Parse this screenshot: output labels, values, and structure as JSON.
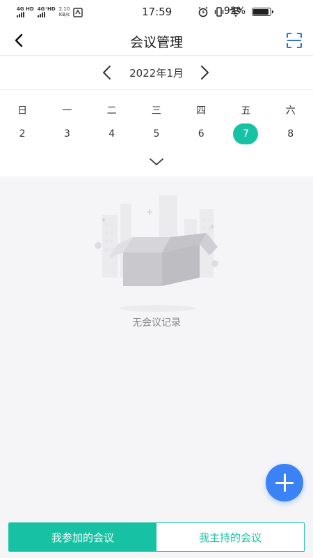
{
  "status_bar": {
    "network_1": "4G HD",
    "network_2": "4G⁺HD",
    "speed_value": "2.10",
    "speed_unit": "KB/s",
    "time": "17:59",
    "battery_percent": "93%",
    "battery_level": 0.93,
    "icons": [
      "signal-icon",
      "signal-icon",
      "sim-icon",
      "alarm-icon",
      "vibrate-icon",
      "wifi-icon",
      "battery-icon"
    ]
  },
  "header": {
    "title": "会议管理",
    "back_icon": "chevron-left-icon",
    "scan_icon": "scan-icon"
  },
  "calendar": {
    "month_label": "2022年1月",
    "weekdays": [
      "日",
      "一",
      "二",
      "三",
      "四",
      "五",
      "六"
    ],
    "dates": [
      "2",
      "3",
      "4",
      "5",
      "6",
      "7",
      "8"
    ],
    "selected_date": "7",
    "expand_icon": "chevron-down-icon"
  },
  "empty_state": {
    "text": "无会议记录",
    "illustration": "empty-box-illustration"
  },
  "fab": {
    "icon": "plus-icon"
  },
  "tabs": [
    {
      "label": "我参加的会议",
      "active": true
    },
    {
      "label": "我主持的会议",
      "active": false
    }
  ],
  "colors": {
    "accent": "#17c2a4",
    "fab": "#3b82f6",
    "background": "#f5f5f7"
  }
}
